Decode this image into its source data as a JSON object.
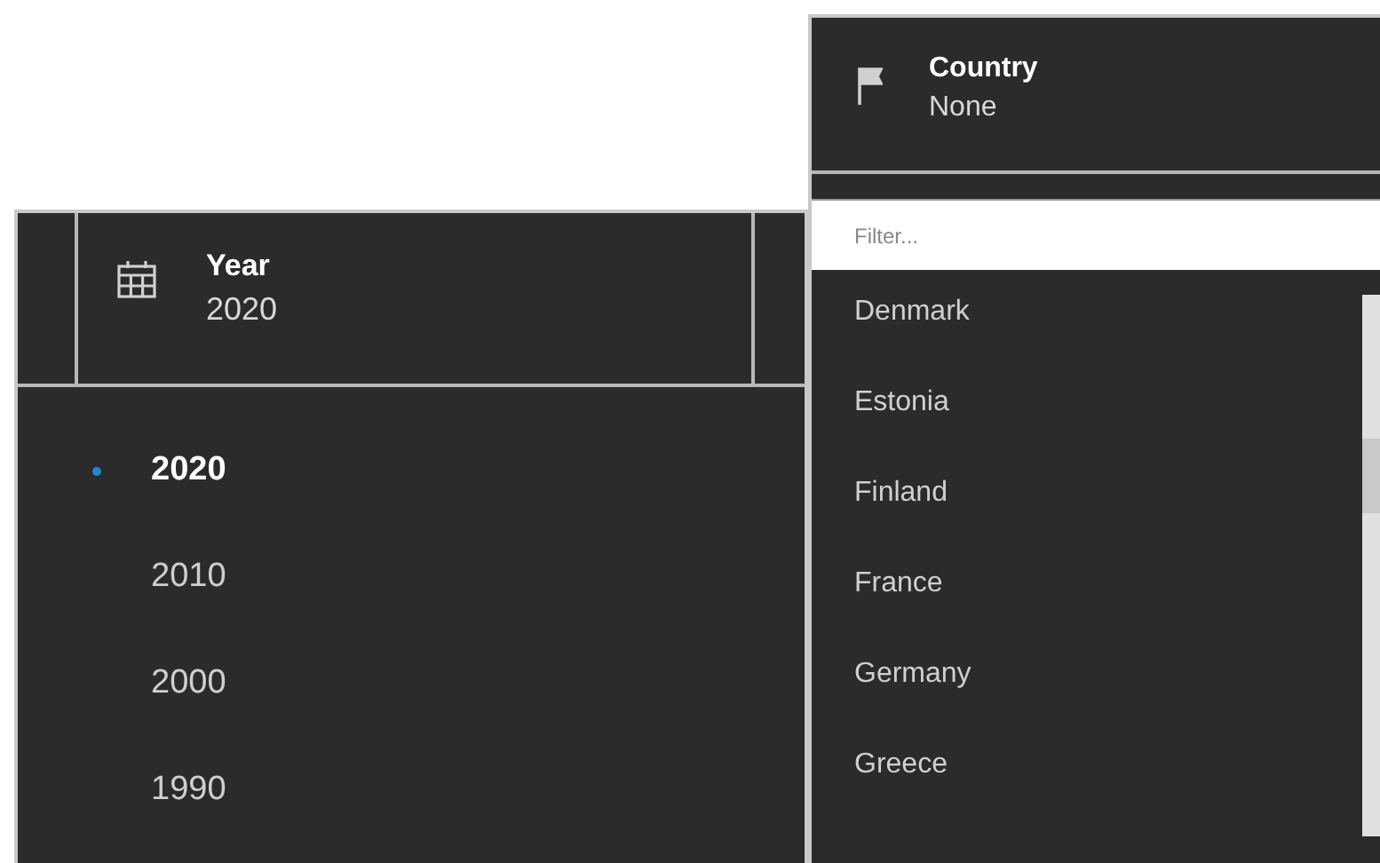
{
  "year_filter": {
    "title": "Year",
    "value": "2020",
    "options": [
      {
        "label": "2020",
        "selected": true
      },
      {
        "label": "2010",
        "selected": false
      },
      {
        "label": "2000",
        "selected": false
      },
      {
        "label": "1990",
        "selected": false
      }
    ]
  },
  "country_filter": {
    "title": "Country",
    "value": "None",
    "search": {
      "placeholder": "Filter..."
    },
    "options": [
      "Denmark",
      "Estonia",
      "Finland",
      "France",
      "Germany",
      "Greece"
    ]
  }
}
